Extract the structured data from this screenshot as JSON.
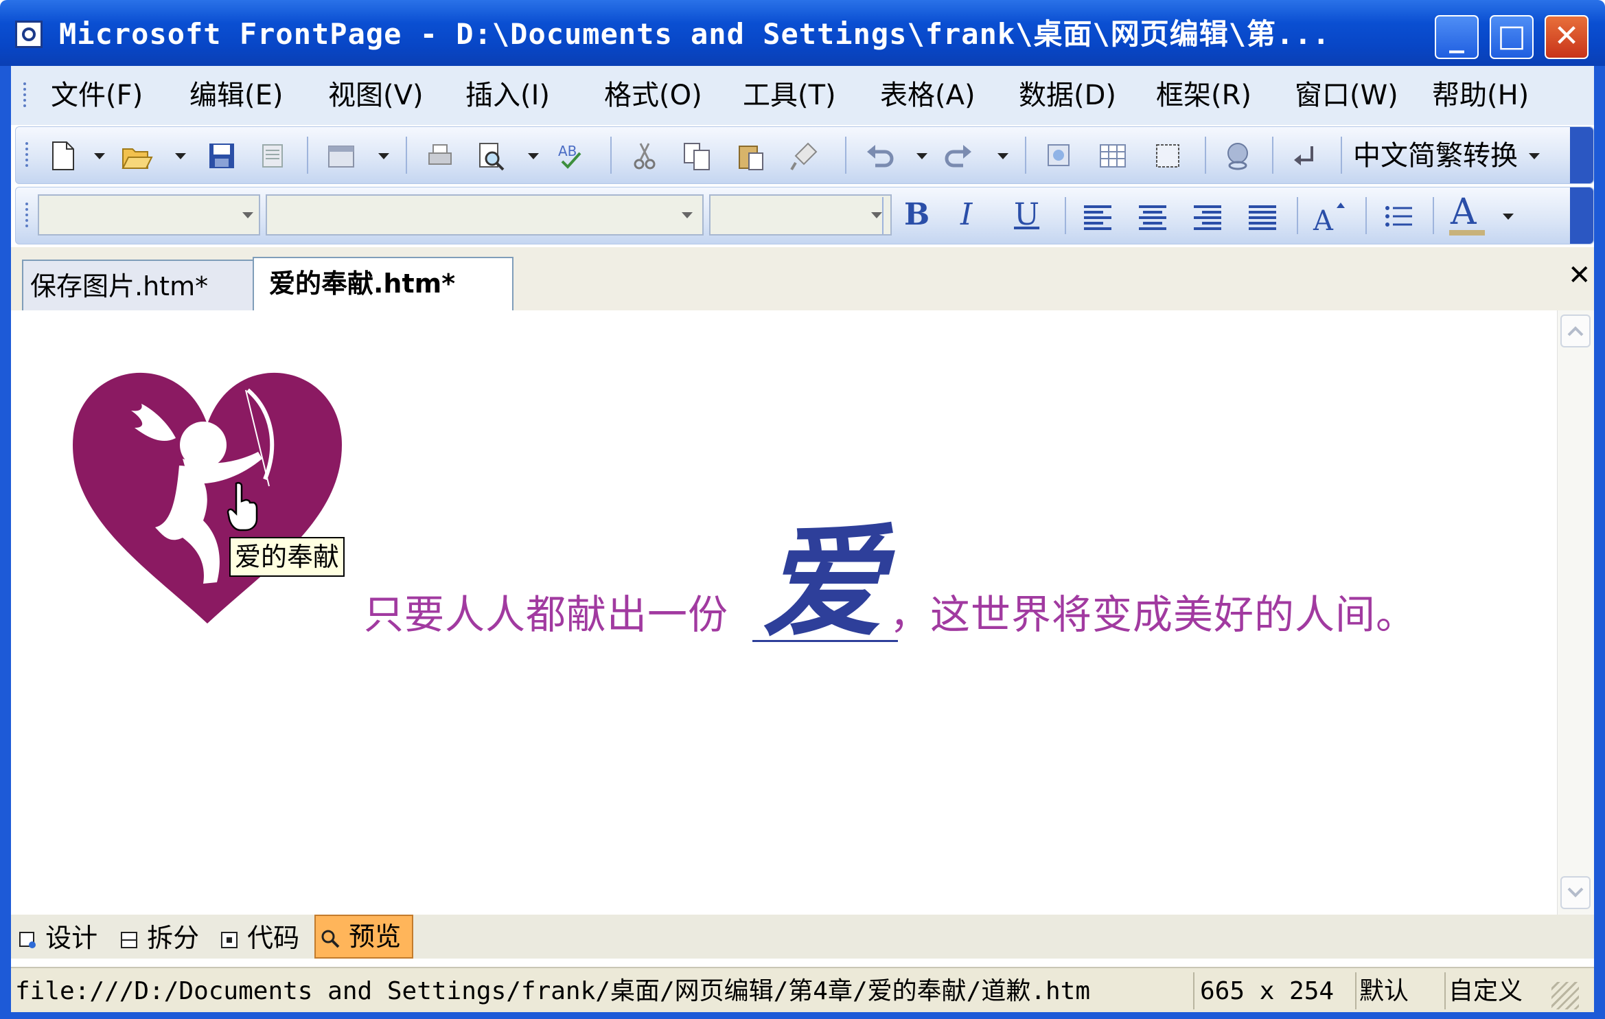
{
  "window": {
    "title": "Microsoft FrontPage - D:\\Documents and Settings\\frank\\桌面\\网页编辑\\第...",
    "minimize_glyph": "_",
    "maximize_glyph": "□",
    "close_glyph": "✕"
  },
  "menubar": {
    "items": [
      "文件(F)",
      "编辑(E)",
      "视图(V)",
      "插入(I)",
      "格式(O)",
      "工具(T)",
      "表格(A)",
      "数据(D)",
      "框架(R)",
      "窗口(W)",
      "帮助(H)"
    ]
  },
  "toolbar_standard": {
    "icons": [
      "new-page-icon",
      "open-icon",
      "save-icon",
      "publish-icon",
      "web-component-icon",
      "print-icon",
      "preview-icon",
      "spelling-icon",
      "cut-icon",
      "copy-icon",
      "paste-icon",
      "format-painter-icon",
      "undo-icon",
      "redo-icon",
      "insert-layer-icon",
      "insert-table-icon",
      "insert-frame-icon",
      "hyperlink-icon",
      "show-all-icon"
    ],
    "convert_label": "中文简繁转换"
  },
  "toolbar_formatting": {
    "style_value": "",
    "font_value": "",
    "size_value": "",
    "bold": "B",
    "italic": "I",
    "underline": "U",
    "font_color_letter": "A"
  },
  "doc_tabs": [
    {
      "label": "保存图片.htm*",
      "active": false
    },
    {
      "label": "爱的奉献.htm*",
      "active": true
    }
  ],
  "close_tab_glyph": "✕",
  "page": {
    "tooltip": "爱的奉献",
    "text_before": "只要人人都献出一份",
    "big_char": "爱",
    "text_after": "，这世界将变成美好的人间。",
    "heart_color": "#8b1a62",
    "text_color": "#a13aa0",
    "big_char_color": "#2e3f9a"
  },
  "view_tabs": [
    {
      "label": "设计",
      "active": false
    },
    {
      "label": "拆分",
      "active": false
    },
    {
      "label": "代码",
      "active": false
    },
    {
      "label": "预览",
      "active": true
    }
  ],
  "statusbar": {
    "path": "file:///D:/Documents and Settings/frank/桌面/网页编辑/第4章/爱的奉献/道歉.htm",
    "dimensions": "665 x 254",
    "mode1": "默认",
    "mode2": "自定义"
  }
}
